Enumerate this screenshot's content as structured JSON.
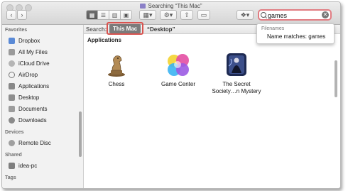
{
  "window": {
    "title": "Searching “This Mac”"
  },
  "toolbar": {
    "back_icon": "chevron-left",
    "forward_icon": "chevron-right",
    "view_modes": [
      "icon-view",
      "list-view",
      "column-view",
      "cover-flow-view"
    ],
    "arrange_icon": "arrange-grid",
    "action_icon": "gear",
    "share_icon": "share",
    "tag_icon": "tag",
    "dropbox_icon": "dropbox"
  },
  "search": {
    "value": "games",
    "placeholder": "Search"
  },
  "dropdown": {
    "header": "Filenames",
    "item": "Name matches: games"
  },
  "sidebar": {
    "favorites_label": "Favorites",
    "favorites": [
      {
        "label": "Dropbox",
        "icon": "dropbox"
      },
      {
        "label": "All My Files",
        "icon": "all-files"
      },
      {
        "label": "iCloud Drive",
        "icon": "cloud"
      },
      {
        "label": "AirDrop",
        "icon": "airdrop"
      },
      {
        "label": "Applications",
        "icon": "applications"
      },
      {
        "label": "Desktop",
        "icon": "desktop"
      },
      {
        "label": "Documents",
        "icon": "documents"
      },
      {
        "label": "Downloads",
        "icon": "downloads"
      }
    ],
    "devices_label": "Devices",
    "devices": [
      {
        "label": "Remote Disc",
        "icon": "disc"
      }
    ],
    "shared_label": "Shared",
    "shared": [
      {
        "label": "idea-pc",
        "icon": "monitor"
      }
    ],
    "tags_label": "Tags"
  },
  "scope": {
    "search_label": "Search:",
    "this_mac": "This Mac",
    "desktop": "“Desktop”"
  },
  "results": {
    "section": "Applications",
    "items": [
      {
        "label": "Chess",
        "icon": "chess"
      },
      {
        "label": "Game Center",
        "icon": "game-center"
      },
      {
        "label": "The Secret Society…n Mystery",
        "label_line1": "The Secret",
        "label_line2": "Society…n Mystery",
        "icon": "secret-society"
      }
    ]
  },
  "colors": {
    "highlight_border": "#d9534f",
    "search_focus": "#e17c82",
    "selected_scope": "#7b7b7b"
  }
}
